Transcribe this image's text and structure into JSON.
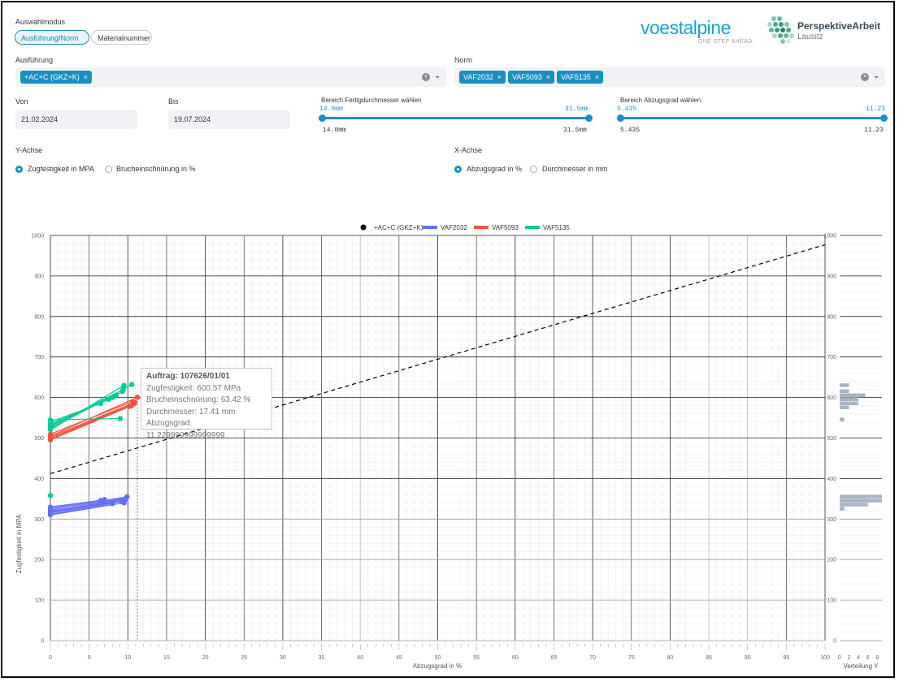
{
  "header": {
    "auswahl_label": "Auswahlmodus",
    "mode_tabs": [
      {
        "label": "Ausführung/Norm",
        "active": true
      },
      {
        "label": "Materialnummer",
        "active": false
      }
    ],
    "brand_main": "voestalpine",
    "brand_tagline": "ONE STEP AHEAD.",
    "partner_name": "PerspektiveArbeit",
    "partner_sub": "Lausitz"
  },
  "filters": {
    "ausfuehrung_label": "Ausführung",
    "ausfuehrung_chips": [
      "+AC+C (GKZ+K)"
    ],
    "norm_label": "Norm",
    "norm_chips": [
      "VAF2032",
      "VAF5093",
      "VAF5135"
    ],
    "chip_remove": "×",
    "clear_glyph": "×",
    "chevron_glyph": "⌄",
    "von_label": "Von",
    "von_value": "21.02.2024",
    "bis_label": "Bis",
    "bis_value": "19.07.2024",
    "diam_label": "Bereich Fertigdurchmesser wählen",
    "diam_min": "14.0mm",
    "diam_max": "31.5mm",
    "abz_label": "Bereich Abzugsgrad wählen",
    "abz_min": "5.435",
    "abz_max": "11.23"
  },
  "axes_select": {
    "y_label": "Y-Achse",
    "y_options": [
      {
        "label": "Zugfestigkeit in MPA",
        "selected": true
      },
      {
        "label": "Brucheinschnürung in %",
        "selected": false
      }
    ],
    "x_label": "X-Achse",
    "x_options": [
      {
        "label": "Abzugsgrad in %",
        "selected": true
      },
      {
        "label": "Durchmesser in mm",
        "selected": false
      }
    ]
  },
  "tooltip": {
    "title": "Auftrag: 107626/01/01",
    "lines": [
      "Zugfestigkeit: 600.57 MPa",
      "Brucheinschnürung: 63.42 %",
      "Durchmesser: 17.41 mm",
      "Abzugsgrad: 11.229999999999999"
    ]
  },
  "colors": {
    "accent": "#1c8fc1",
    "vaf2032": "#636efa",
    "vaf5093": "#ef553b",
    "vaf5135": "#00cc96",
    "hist": "#aab4c4"
  },
  "chart_data": {
    "type": "scatter",
    "xlabel": "Abzugsgrad in %",
    "ylabel": "Zugfestigkeit in MPA",
    "xlim": [
      0,
      100
    ],
    "ylim": [
      0,
      1000
    ],
    "x_ticks": [
      0,
      5,
      10,
      15,
      20,
      25,
      30,
      35,
      40,
      45,
      50,
      55,
      60,
      65,
      70,
      75,
      80,
      85,
      90,
      95,
      100
    ],
    "y_ticks": [
      0,
      100,
      200,
      300,
      400,
      500,
      600,
      700,
      800,
      900,
      1000
    ],
    "legend": [
      "+AC+C (GKZ+K)",
      "VAF2032",
      "VAF5093",
      "VAF5135"
    ],
    "legend_position": "top",
    "reference_line": {
      "x": [
        0,
        100
      ],
      "y": [
        412,
        977
      ],
      "style": "dashed"
    },
    "hover_x": 11.23,
    "series": [
      {
        "name": "VAF2032",
        "color": "#636efa",
        "lines": [
          [
            [
              0,
              310
            ],
            [
              9.5,
              340
            ]
          ],
          [
            [
              0,
              315
            ],
            [
              9.5,
              345
            ]
          ],
          [
            [
              0,
              318
            ],
            [
              9.7,
              350
            ]
          ],
          [
            [
              0,
              322
            ],
            [
              9.8,
              352
            ]
          ],
          [
            [
              0,
              325
            ],
            [
              9.9,
              355
            ]
          ],
          [
            [
              0,
              328
            ],
            [
              7,
              348
            ]
          ],
          [
            [
              0,
              330
            ],
            [
              6.5,
              346
            ]
          ],
          [
            [
              0,
              320
            ],
            [
              9.2,
              343
            ]
          ],
          [
            [
              0,
              312
            ],
            [
              8,
              338
            ]
          ],
          [
            [
              0,
              317
            ],
            [
              9.6,
              347
            ]
          ]
        ],
        "points": [
          [
            9.5,
            340
          ],
          [
            9.5,
            345
          ],
          [
            9.7,
            350
          ],
          [
            9.8,
            352
          ],
          [
            9.9,
            355
          ],
          [
            7,
            348
          ],
          [
            6.5,
            346
          ],
          [
            9.2,
            343
          ],
          [
            8,
            338
          ],
          [
            9.6,
            347
          ]
        ]
      },
      {
        "name": "VAF5093",
        "color": "#ef553b",
        "lines": [
          [
            [
              0,
              495
            ],
            [
              10.5,
              580
            ]
          ],
          [
            [
              0,
              500
            ],
            [
              10.8,
              585
            ]
          ],
          [
            [
              0,
              505
            ],
            [
              11.23,
              600.57
            ]
          ],
          [
            [
              0,
              510
            ],
            [
              10.6,
              590
            ]
          ],
          [
            [
              0,
              498
            ],
            [
              10.2,
              578
            ]
          ],
          [
            [
              0,
              503
            ],
            [
              10.9,
              588
            ]
          ]
        ],
        "points": [
          [
            10.5,
            580
          ],
          [
            10.8,
            585
          ],
          [
            11.23,
            600.57
          ],
          [
            10.6,
            590
          ],
          [
            10.2,
            578
          ],
          [
            10.9,
            588
          ]
        ]
      },
      {
        "name": "VAF5135",
        "color": "#00cc96",
        "lines": [
          [
            [
              0,
              520
            ],
            [
              9.5,
              630
            ]
          ],
          [
            [
              0,
              525
            ],
            [
              9.3,
              615
            ]
          ],
          [
            [
              0,
              530
            ],
            [
              8.5,
              605
            ]
          ],
          [
            [
              0,
              535
            ],
            [
              7.5,
              595
            ]
          ],
          [
            [
              0,
              540
            ],
            [
              6.5,
              585
            ]
          ],
          [
            [
              0,
              545
            ],
            [
              9.0,
              548
            ]
          ],
          [
            [
              0,
              522
            ],
            [
              10.5,
              632
            ]
          ],
          [
            [
              0,
              528
            ],
            [
              9.4,
              620
            ]
          ],
          [
            [
              0,
              533
            ],
            [
              8.0,
              600
            ]
          ]
        ],
        "points": [
          [
            9.5,
            630
          ],
          [
            9.3,
            615
          ],
          [
            8.5,
            605
          ],
          [
            7.5,
            595
          ],
          [
            6.5,
            585
          ],
          [
            9.0,
            548
          ],
          [
            10.5,
            632
          ],
          [
            9.4,
            620
          ],
          [
            8.0,
            600
          ],
          [
            0,
            358
          ]
        ]
      }
    ],
    "side_histogram": {
      "xlabel": "Verteilung Y",
      "x_ticks": [
        0,
        2,
        4,
        6,
        8
      ],
      "bins": [
        {
          "y": 630,
          "count": 2
        },
        {
          "y": 615,
          "count": 2
        },
        {
          "y": 605,
          "count": 5.5
        },
        {
          "y": 595,
          "count": 4
        },
        {
          "y": 585,
          "count": 4
        },
        {
          "y": 575,
          "count": 2
        },
        {
          "y": 545,
          "count": 1
        },
        {
          "y": 355,
          "count": 9
        },
        {
          "y": 345,
          "count": 9
        },
        {
          "y": 335,
          "count": 6
        },
        {
          "y": 325,
          "count": 1
        }
      ]
    }
  }
}
